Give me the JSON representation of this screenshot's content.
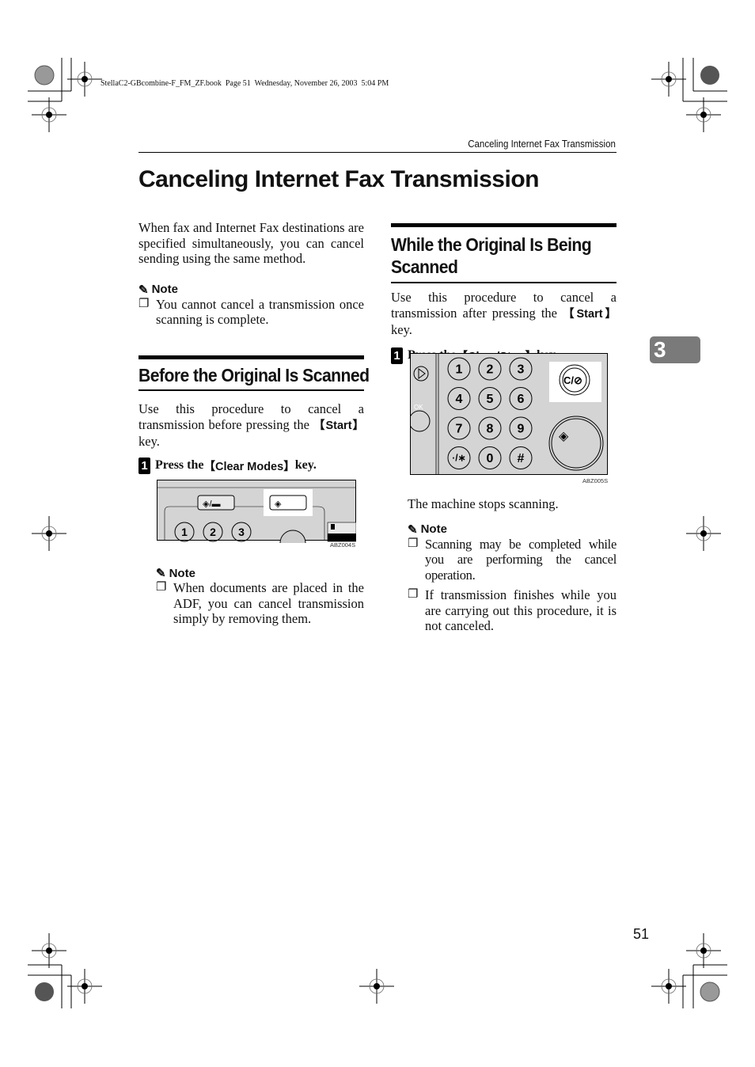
{
  "file_info": "StellaC2-GBcombine-F_FM_ZF.book  Page 51  Wednesday, November 26, 2003  5:04 PM",
  "running_header": "Canceling Internet Fax Transmission",
  "title": "Canceling Internet Fax Transmission",
  "chapter_tab": "3",
  "page_number": "51",
  "intro": {
    "text": "When fax and Internet Fax destinations are specified simultaneously, you can cancel sending using the same method.",
    "note_label": "Note",
    "notes": [
      "You cannot cancel a transmission once scanning is complete."
    ]
  },
  "section_before": {
    "heading": "Before the Original Is Scanned",
    "text_before": "Use this procedure to cancel a transmission before pressing the ",
    "key": "【Start】",
    "text_after": " key.",
    "step": {
      "number": "1",
      "prefix": "Press the ",
      "key": "【Clear Modes】",
      "suffix": " key."
    },
    "figure_caption": "ABZ004S",
    "keypad_keys": [
      "1",
      "2",
      "3"
    ],
    "note_label": "Note",
    "notes": [
      "When documents are placed in the ADF, you can cancel transmission simply by removing them."
    ]
  },
  "section_while": {
    "heading_line1": "While the Original Is Being",
    "heading_line2": "Scanned",
    "text_before": "Use this procedure to cancel a transmission after pressing the ",
    "key": "【Start】",
    "text_after": " key.",
    "step": {
      "number": "1",
      "prefix": "Press the ",
      "key": "【Clear/Stop】",
      "suffix": " key."
    },
    "figure_caption": "ABZ005S",
    "keypad_keys": [
      "1",
      "2",
      "3",
      "4",
      "5",
      "6",
      "7",
      "8",
      "9",
      "·/∗",
      "0",
      "#"
    ],
    "ok_label": "OK",
    "clear_stop_label": "C/⊘",
    "result": "The machine stops scanning.",
    "note_label": "Note",
    "notes": [
      "Scanning may be completed while you are performing the cancel operation.",
      "If transmission finishes while you are carrying out this procedure, it is not canceled."
    ]
  }
}
